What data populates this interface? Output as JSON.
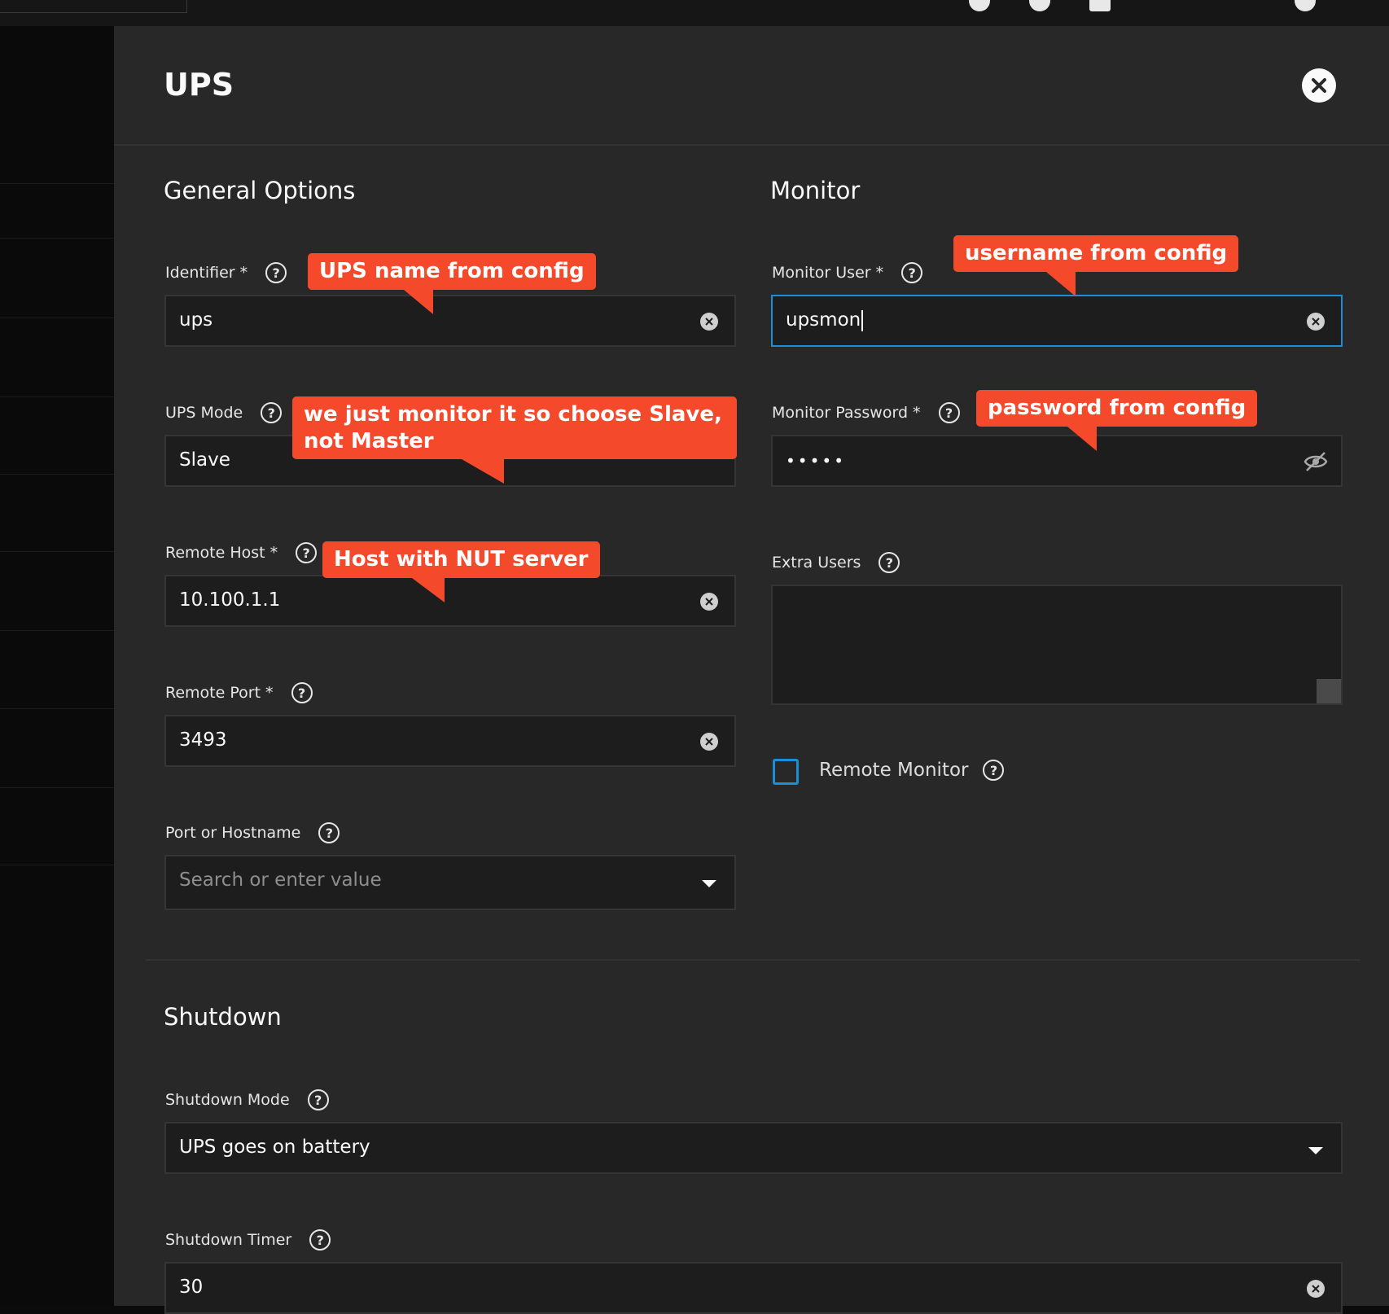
{
  "dialog": {
    "title": "UPS",
    "close_icon": "close-icon"
  },
  "general": {
    "title": "General Options",
    "identifier": {
      "label": "Identifier *",
      "value": "ups"
    },
    "ups_mode": {
      "label": "UPS Mode",
      "value": "Slave"
    },
    "remote_host": {
      "label": "Remote Host *",
      "value": "10.100.1.1"
    },
    "remote_port": {
      "label": "Remote Port *",
      "value": "3493"
    },
    "port_or_hostname": {
      "label": "Port or Hostname",
      "placeholder": "Search or enter value"
    }
  },
  "monitor": {
    "title": "Monitor",
    "user": {
      "label": "Monitor User *",
      "value": "upsmon"
    },
    "password": {
      "label": "Monitor Password *",
      "value": "•••••"
    },
    "extra_users": {
      "label": "Extra Users",
      "value": ""
    },
    "remote_monitor": {
      "label": "Remote Monitor",
      "checked": false
    }
  },
  "shutdown": {
    "title": "Shutdown",
    "mode": {
      "label": "Shutdown Mode",
      "value": "UPS goes on battery"
    },
    "timer": {
      "label": "Shutdown Timer",
      "value": "30"
    }
  },
  "annotations": {
    "identifier_note": "UPS name from config",
    "mode_note": "we just monitor it so choose Slave, not Master",
    "host_note": "Host with NUT server",
    "user_note": "username from config",
    "password_note": "password from config"
  },
  "help_glyph": "?",
  "colors": {
    "accent": "#1a8ed6",
    "callout": "#f4492a",
    "panel": "#282828",
    "input": "#1d1d1d"
  }
}
